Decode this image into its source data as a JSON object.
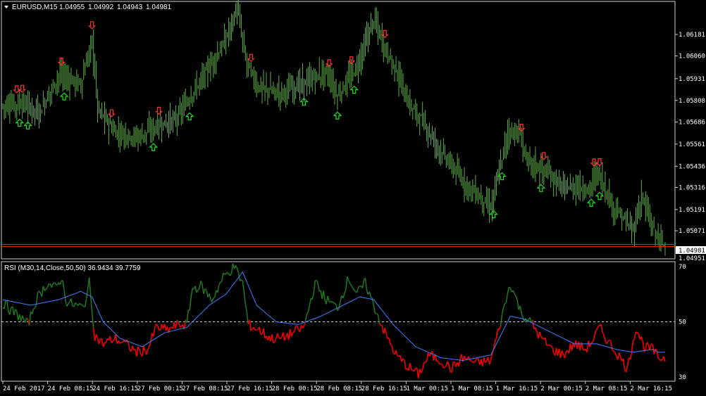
{
  "chart_data": [
    {
      "type": "ohlc",
      "symbol": "EURUSD,M15",
      "ohlc_current": [
        "1.04955",
        "1.04992",
        "1.04943",
        "1.04981"
      ],
      "current_price": "1.04981",
      "extra_price_label": "1.04951",
      "y_tick_labels": [
        "1.06181",
        "1.06060",
        "1.05931",
        "1.05808",
        "1.05686",
        "1.05561",
        "1.05436",
        "1.05316",
        "1.05191",
        "1.05071",
        "1.04951"
      ],
      "ylim": [
        1.0492,
        1.0636
      ],
      "colors": {
        "bars": "#5fae4a",
        "arrow_up": "#22dd22",
        "arrow_down": "#ff3333",
        "price_line": "#ff2222"
      },
      "x": [
        0,
        1,
        2,
        3,
        4,
        5,
        6,
        7,
        8,
        9,
        10,
        11,
        12,
        13,
        14,
        15,
        16,
        17,
        18,
        19,
        20,
        21,
        22,
        23,
        24,
        25,
        26,
        27,
        28,
        29,
        30,
        31,
        32,
        33,
        34,
        35,
        36,
        37,
        38,
        39,
        40,
        41,
        42,
        43,
        44,
        45,
        46,
        47,
        48,
        49,
        50,
        51,
        52,
        53,
        54,
        55,
        56,
        57,
        58,
        59,
        60,
        61,
        62,
        63,
        64,
        65,
        66,
        67,
        68,
        69,
        70,
        71,
        72,
        73,
        74,
        75,
        76,
        77,
        78,
        79,
        80,
        81,
        82,
        83,
        84,
        85,
        86,
        87,
        88,
        89,
        90,
        91,
        92,
        93,
        94,
        95,
        96,
        97,
        98,
        99,
        100,
        101,
        102,
        103,
        104,
        105,
        106,
        107,
        108,
        109,
        110,
        111,
        112,
        113,
        114,
        115,
        116,
        117,
        118,
        119,
        120,
        121,
        122,
        123,
        124,
        125,
        126,
        127,
        128,
        129,
        130,
        131,
        132,
        133,
        134,
        135,
        136,
        137,
        138,
        139,
        140,
        141,
        142,
        143,
        144,
        145,
        146,
        147,
        148,
        149,
        150,
        151,
        152,
        153,
        154,
        155,
        156,
        157,
        158,
        159,
        160,
        161,
        162,
        163,
        164,
        165,
        166,
        167,
        168,
        169,
        170,
        171,
        172,
        173,
        174,
        175,
        176,
        177,
        178,
        179,
        180,
        181,
        182,
        183,
        184,
        185,
        186,
        187,
        188,
        189,
        190,
        191,
        192,
        193,
        194,
        195,
        196,
        197,
        198,
        199,
        200,
        201,
        202,
        203,
        204,
        205,
        206,
        207,
        208,
        209,
        210,
        211,
        212,
        213,
        214,
        215,
        216,
        217,
        218,
        219,
        220,
        221,
        222,
        223,
        224,
        225,
        226,
        227,
        228,
        229,
        230,
        231,
        232,
        233,
        234,
        235,
        236,
        237,
        238,
        239,
        240,
        241,
        242,
        243,
        244,
        245,
        246,
        247,
        248,
        249,
        250,
        251,
        252,
        253,
        254,
        255,
        256,
        257,
        258,
        259,
        260,
        261,
        262,
        263,
        264,
        265,
        266,
        267,
        268,
        269,
        270,
        271,
        272,
        273,
        274,
        275,
        276,
        277,
        278,
        279,
        280,
        281,
        282,
        283,
        284,
        285,
        286,
        287,
        288,
        289,
        290,
        291,
        292,
        293,
        294,
        295,
        296,
        297,
        298,
        299,
        300,
        301,
        302,
        303,
        304,
        305,
        306,
        307,
        308,
        309,
        310,
        311,
        312,
        313,
        314,
        315,
        316,
        317,
        318,
        319,
        320,
        321,
        322,
        323,
        324,
        325,
        326,
        327,
        328,
        329,
        330,
        331,
        332,
        333,
        334,
        335,
        336,
        337,
        338,
        339,
        340,
        341,
        342,
        343,
        344,
        345,
        346,
        347,
        348,
        349,
        350,
        351,
        352,
        353,
        354,
        355,
        356,
        357,
        358,
        359,
        360,
        361,
        362,
        363,
        364,
        365,
        366,
        367,
        368,
        369,
        370,
        371,
        372,
        373,
        374,
        375,
        376,
        377,
        378,
        379,
        380,
        381,
        382,
        383,
        384,
        385,
        386,
        387,
        388,
        389,
        390,
        391,
        392,
        393,
        394,
        395,
        396,
        397,
        398,
        399,
        400,
        401,
        402,
        403,
        404,
        405,
        406,
        407,
        408,
        409,
        410,
        411,
        412,
        413,
        414,
        415,
        416,
        417,
        418,
        419,
        420,
        421,
        422,
        423,
        424,
        425,
        426,
        427,
        428,
        429,
        430,
        431,
        432,
        433,
        434,
        435,
        436,
        437,
        438,
        439,
        440,
        441,
        442,
        443,
        444,
        445,
        446,
        447,
        448,
        449,
        450,
        451,
        452,
        453,
        454,
        455,
        456,
        457,
        458,
        459,
        460,
        461,
        462,
        463,
        464,
        465,
        466,
        467,
        468,
        469,
        470,
        471,
        472,
        473,
        474,
        475
      ],
      "close_ticks": [
        [
          0,
          1.0578
        ],
        [
          14,
          1.0579
        ],
        [
          26,
          1.0574
        ],
        [
          40,
          1.0595
        ],
        [
          56,
          1.059
        ],
        [
          64,
          1.0615
        ],
        [
          68,
          1.0576
        ],
        [
          80,
          1.0563
        ],
        [
          96,
          1.056
        ],
        [
          110,
          1.0566
        ],
        [
          124,
          1.057
        ],
        [
          140,
          1.059
        ],
        [
          158,
          1.0612
        ],
        [
          168,
          1.0633
        ],
        [
          174,
          1.0604
        ],
        [
          182,
          1.0589
        ],
        [
          198,
          1.0585
        ],
        [
          214,
          1.059
        ],
        [
          232,
          1.0597
        ],
        [
          240,
          1.0583
        ],
        [
          254,
          1.06
        ],
        [
          266,
          1.0627
        ],
        [
          274,
          1.061
        ],
        [
          282,
          1.0598
        ],
        [
          290,
          1.058
        ],
        [
          300,
          1.057
        ],
        [
          314,
          1.0552
        ],
        [
          330,
          1.0535
        ],
        [
          342,
          1.0526
        ],
        [
          350,
          1.052
        ],
        [
          362,
          1.0563
        ],
        [
          370,
          1.0562
        ],
        [
          376,
          1.0547
        ],
        [
          390,
          1.054
        ],
        [
          402,
          1.0531
        ],
        [
          412,
          1.0532
        ],
        [
          420,
          1.053
        ],
        [
          426,
          1.0541
        ],
        [
          438,
          1.052
        ],
        [
          452,
          1.0507
        ],
        [
          458,
          1.0527
        ],
        [
          466,
          1.0508
        ],
        [
          475,
          1.0498
        ]
      ],
      "arrows_up": [
        12,
        18,
        44,
        108,
        134,
        216,
        240,
        252,
        352,
        358,
        386,
        422,
        428
      ],
      "arrows_down": [
        10,
        14,
        42,
        64,
        78,
        112,
        178,
        234,
        250,
        274,
        372,
        388,
        424,
        428
      ]
    },
    {
      "type": "line",
      "title": "RSI (M30,14,Close,50,50) 36.9434 39.7759",
      "y_tick_labels": [
        "70",
        "50",
        "30"
      ],
      "ylim": [
        29,
        71
      ],
      "level": 50,
      "colors": {
        "above": "#1f7a1f",
        "below": "#ff0000",
        "signal": "#3f7fff",
        "level": "#cccccc"
      },
      "rsi_ticks": [
        [
          0,
          57
        ],
        [
          6,
          54
        ],
        [
          12,
          52
        ],
        [
          18,
          49
        ],
        [
          24,
          58
        ],
        [
          32,
          64
        ],
        [
          38,
          62
        ],
        [
          42,
          66
        ],
        [
          46,
          57
        ],
        [
          52,
          56
        ],
        [
          58,
          55
        ],
        [
          62,
          64
        ],
        [
          66,
          45
        ],
        [
          72,
          42
        ],
        [
          80,
          44
        ],
        [
          88,
          42
        ],
        [
          96,
          39
        ],
        [
          104,
          40
        ],
        [
          110,
          48
        ],
        [
          118,
          47
        ],
        [
          126,
          49
        ],
        [
          132,
          49
        ],
        [
          136,
          62
        ],
        [
          142,
          63
        ],
        [
          150,
          58
        ],
        [
          158,
          66
        ],
        [
          166,
          70
        ],
        [
          172,
          64
        ],
        [
          176,
          49
        ],
        [
          184,
          47
        ],
        [
          192,
          44
        ],
        [
          200,
          44
        ],
        [
          208,
          46
        ],
        [
          216,
          48
        ],
        [
          224,
          64
        ],
        [
          232,
          58
        ],
        [
          240,
          55
        ],
        [
          248,
          66
        ],
        [
          254,
          60
        ],
        [
          260,
          64
        ],
        [
          266,
          56
        ],
        [
          274,
          46
        ],
        [
          282,
          38
        ],
        [
          290,
          34
        ],
        [
          298,
          31
        ],
        [
          306,
          38
        ],
        [
          314,
          36
        ],
        [
          322,
          33
        ],
        [
          330,
          37
        ],
        [
          340,
          35
        ],
        [
          350,
          36
        ],
        [
          356,
          48
        ],
        [
          364,
          64
        ],
        [
          372,
          53
        ],
        [
          380,
          49
        ],
        [
          386,
          44
        ],
        [
          394,
          40
        ],
        [
          402,
          38
        ],
        [
          410,
          42
        ],
        [
          418,
          40
        ],
        [
          424,
          44
        ],
        [
          428,
          48
        ],
        [
          434,
          43
        ],
        [
          440,
          39
        ],
        [
          448,
          33
        ],
        [
          454,
          48
        ],
        [
          460,
          41
        ],
        [
          466,
          40
        ],
        [
          470,
          37
        ]
      ],
      "signal_ticks": [
        [
          0,
          58
        ],
        [
          20,
          56
        ],
        [
          40,
          58
        ],
        [
          56,
          61
        ],
        [
          64,
          59
        ],
        [
          72,
          50
        ],
        [
          84,
          44
        ],
        [
          100,
          41
        ],
        [
          116,
          46
        ],
        [
          132,
          48
        ],
        [
          148,
          56
        ],
        [
          160,
          60
        ],
        [
          172,
          68
        ],
        [
          182,
          56
        ],
        [
          196,
          50
        ],
        [
          212,
          49
        ],
        [
          228,
          52
        ],
        [
          244,
          56
        ],
        [
          256,
          59
        ],
        [
          266,
          58
        ],
        [
          280,
          49
        ],
        [
          296,
          41
        ],
        [
          314,
          37
        ],
        [
          330,
          36
        ],
        [
          350,
          38
        ],
        [
          364,
          52
        ],
        [
          374,
          51
        ],
        [
          390,
          47
        ],
        [
          410,
          42
        ],
        [
          426,
          42
        ],
        [
          440,
          40
        ],
        [
          452,
          39
        ],
        [
          466,
          40
        ],
        [
          470,
          39
        ]
      ]
    }
  ],
  "time_axis": {
    "labels": [
      "24 Feb 2017",
      "24 Feb 08:15",
      "24 Feb 16:15",
      "27 Feb 00:15",
      "27 Feb 08:15",
      "27 Feb 16:15",
      "28 Feb 00:15",
      "28 Feb 08:15",
      "28 Feb 16:15",
      "1 Mar 00:15",
      "1 Mar 08:15",
      "1 Mar 16:15",
      "2 Mar 00:15",
      "2 Mar 08:15",
      "2 Mar 16:15"
    ]
  }
}
